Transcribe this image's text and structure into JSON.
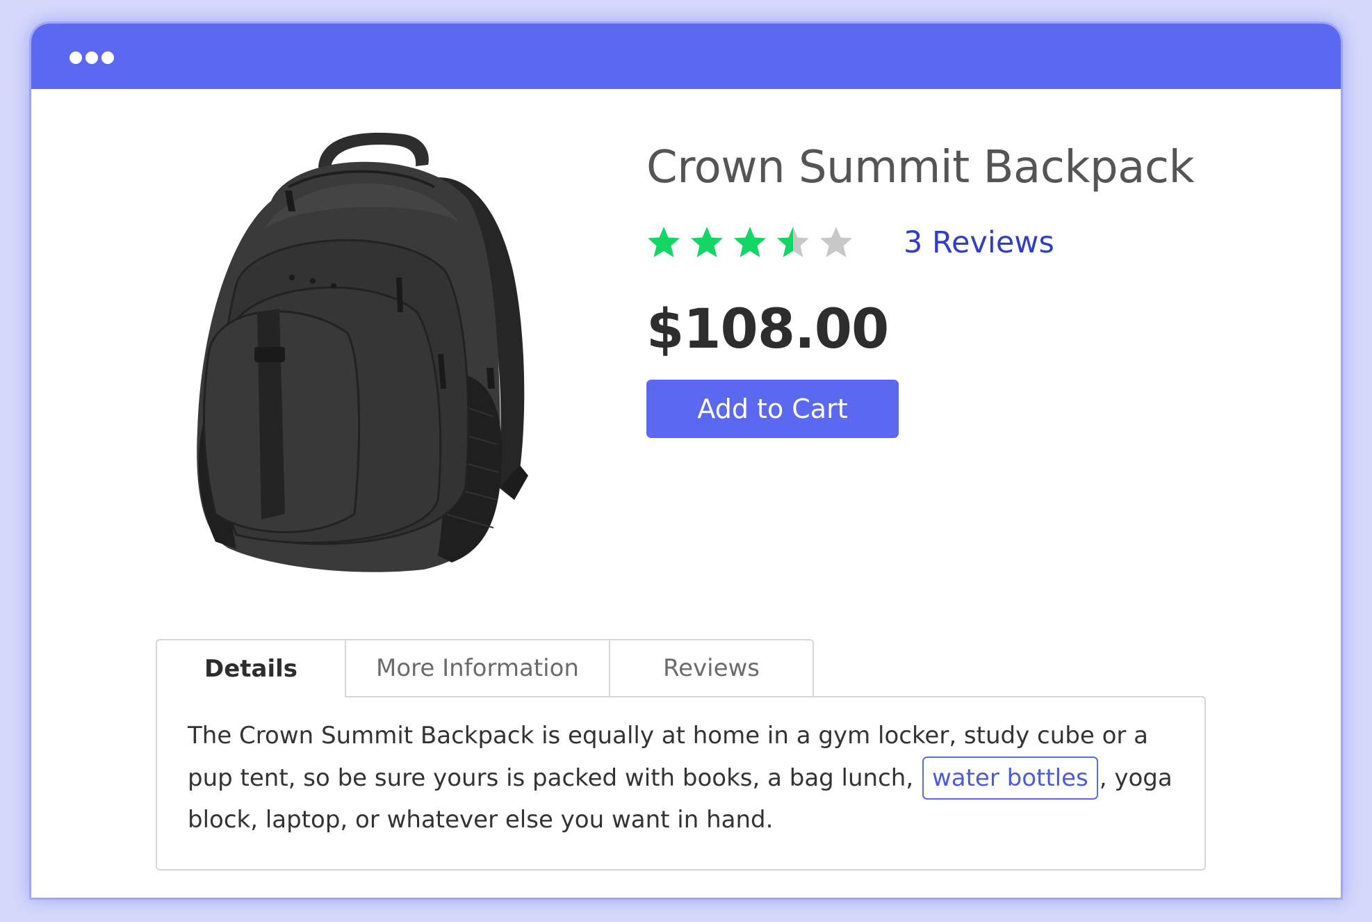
{
  "colors": {
    "accent": "#5a69f0",
    "page_background": "#d4d8fb",
    "star_filled": "#14d664",
    "star_empty": "#c8c8c8",
    "reviews_link": "#2f3ec6"
  },
  "window": {
    "menu_icon": "three-dots-icon"
  },
  "product": {
    "image_icon": "backpack-image",
    "title": "Crown Summit Backpack",
    "rating": 3.5,
    "rating_max": 5,
    "reviews_link": "3 Reviews",
    "price": "$108.00",
    "add_to_cart_label": "Add to Cart"
  },
  "tabs": [
    {
      "label": "Details",
      "active": true
    },
    {
      "label": "More Information",
      "active": false
    },
    {
      "label": "Reviews",
      "active": false
    }
  ],
  "details": {
    "text_before_link": "The Crown Summit Backpack is equally at home in a gym locker, study cube or a pup tent, so be sure yours is packed with books, a bag lunch, ",
    "link_text": "water bottles",
    "text_after_link": ", yoga block, laptop, or whatever else you want in hand."
  }
}
